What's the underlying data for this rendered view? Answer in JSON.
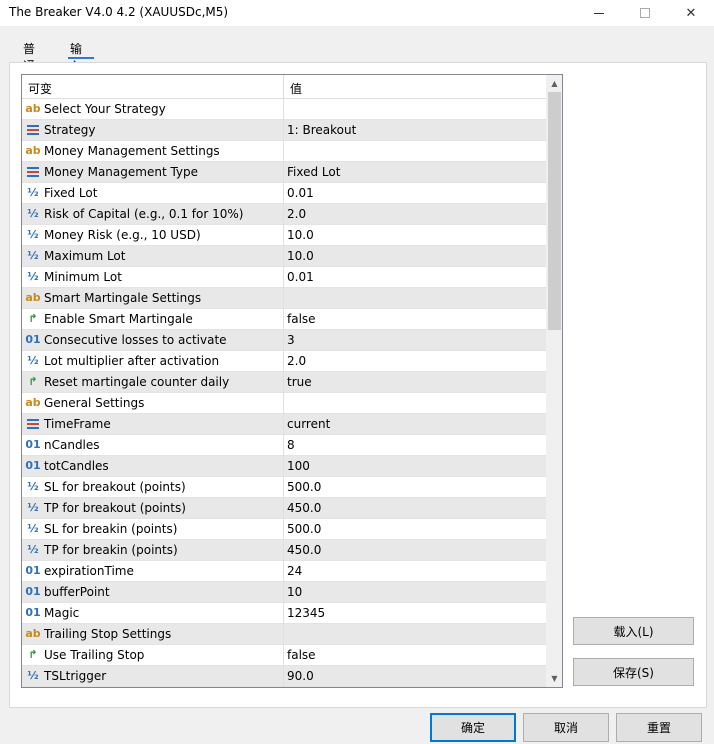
{
  "window": {
    "title": "The Breaker V4.0 4.2 (XAUUSDc,M5)"
  },
  "tabs": [
    {
      "label": "普通"
    },
    {
      "label": "输入"
    }
  ],
  "grid": {
    "headers": {
      "variable": "可变",
      "value": "值"
    },
    "rows": [
      {
        "icon": "ab",
        "name": "Select Your Strategy",
        "value": ""
      },
      {
        "icon": "enum",
        "name": "Strategy",
        "value": "1: Breakout"
      },
      {
        "icon": "ab",
        "name": "Money Management Settings",
        "value": ""
      },
      {
        "icon": "enum",
        "name": "Money Management Type",
        "value": "Fixed Lot"
      },
      {
        "icon": "half",
        "name": "Fixed Lot",
        "value": "0.01"
      },
      {
        "icon": "half",
        "name": "Risk of Capital (e.g., 0.1 for 10%)",
        "value": "2.0"
      },
      {
        "icon": "half",
        "name": "Money Risk (e.g., 10 USD)",
        "value": "10.0"
      },
      {
        "icon": "half",
        "name": "Maximum Lot",
        "value": "10.0"
      },
      {
        "icon": "half",
        "name": "Minimum Lot",
        "value": "0.01"
      },
      {
        "icon": "ab",
        "name": "Smart Martingale Settings",
        "value": ""
      },
      {
        "icon": "flag",
        "name": "Enable Smart Martingale",
        "value": "false"
      },
      {
        "icon": "01",
        "name": "Consecutive losses to activate",
        "value": "3"
      },
      {
        "icon": "half",
        "name": "Lot multiplier after activation",
        "value": "2.0"
      },
      {
        "icon": "flag",
        "name": "Reset martingale counter daily",
        "value": "true"
      },
      {
        "icon": "ab",
        "name": "General Settings",
        "value": ""
      },
      {
        "icon": "enum",
        "name": "TimeFrame",
        "value": "current"
      },
      {
        "icon": "01",
        "name": "nCandles",
        "value": "8"
      },
      {
        "icon": "01",
        "name": "totCandles",
        "value": "100"
      },
      {
        "icon": "half",
        "name": "SL for breakout (points)",
        "value": "500.0"
      },
      {
        "icon": "half",
        "name": "TP for breakout (points)",
        "value": "450.0"
      },
      {
        "icon": "half",
        "name": "SL for breakin (points)",
        "value": "500.0"
      },
      {
        "icon": "half",
        "name": "TP for breakin (points)",
        "value": "450.0"
      },
      {
        "icon": "01",
        "name": "expirationTime",
        "value": "24"
      },
      {
        "icon": "01",
        "name": "bufferPoint",
        "value": "10"
      },
      {
        "icon": "01",
        "name": "Magic",
        "value": "12345"
      },
      {
        "icon": "ab",
        "name": "Trailing Stop Settings",
        "value": ""
      },
      {
        "icon": "flag",
        "name": "Use Trailing Stop",
        "value": "false"
      },
      {
        "icon": "half",
        "name": "TSLtrigger",
        "value": "90.0"
      }
    ]
  },
  "side_buttons": {
    "load": "载入(L)",
    "save": "保存(S)"
  },
  "footer_buttons": {
    "ok": "确定",
    "cancel": "取消",
    "reset": "重置"
  },
  "colors": {
    "accent": "#0078d7",
    "tab_underline": "#2a7ad8",
    "icon_blue": "#2d6fc0",
    "icon_orange": "#c68a1a",
    "icon_green": "#2e9b3a"
  }
}
